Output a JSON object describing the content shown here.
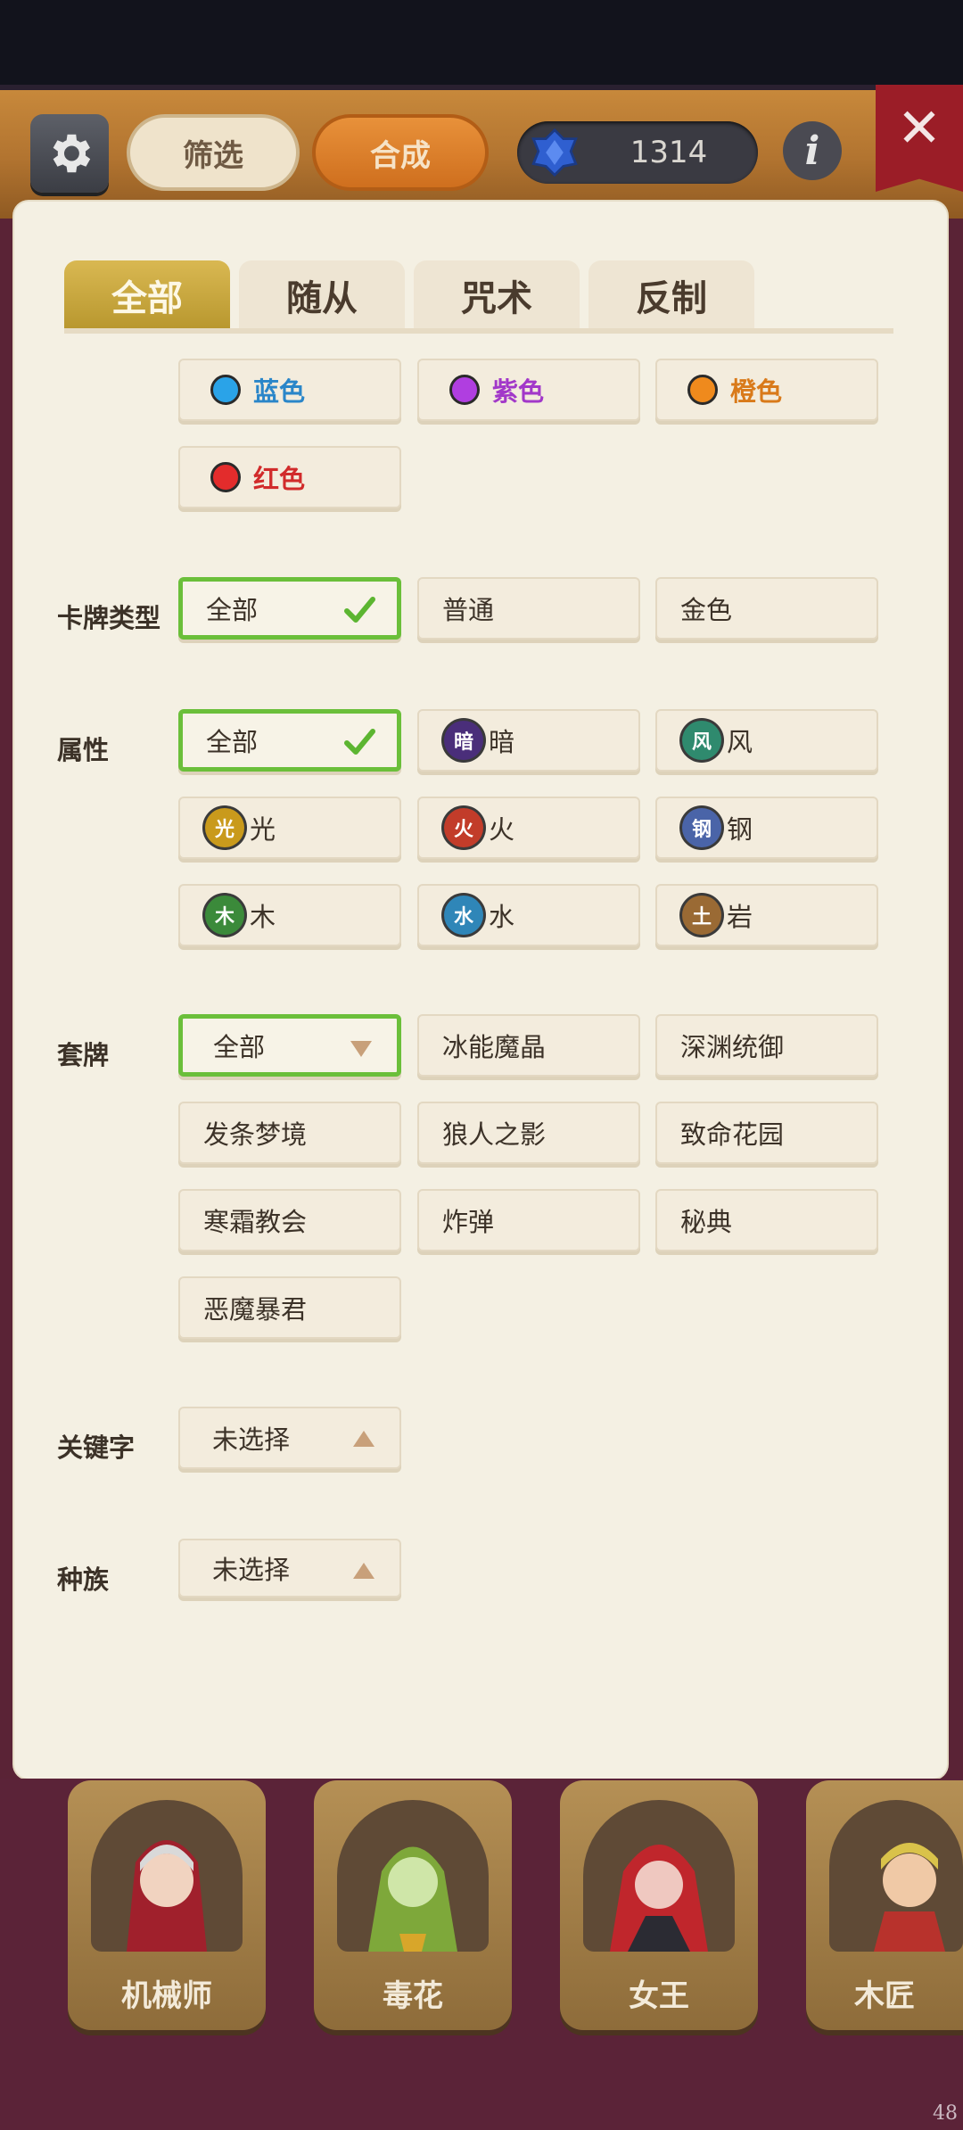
{
  "header": {
    "filter_label": "筛选",
    "compose_label": "合成",
    "gem_count": "1314",
    "info_label": "i"
  },
  "tabs": [
    {
      "label": "全部",
      "active": true
    },
    {
      "label": "随从",
      "active": false
    },
    {
      "label": "咒术",
      "active": false
    },
    {
      "label": "反制",
      "active": false
    }
  ],
  "colors": [
    {
      "label": "蓝色",
      "color": "#2aa3e8",
      "text_color": "#2a86c9"
    },
    {
      "label": "紫色",
      "color": "#b03ee0",
      "text_color": "#a238c9"
    },
    {
      "label": "橙色",
      "color": "#ef8a1d",
      "text_color": "#d97a1a"
    },
    {
      "label": "红色",
      "color": "#e32c2c",
      "text_color": "#d12b2b"
    }
  ],
  "card_type": {
    "label": "卡牌类型",
    "options": [
      "全部",
      "普通",
      "金色"
    ]
  },
  "attribute": {
    "label": "属性",
    "all": "全部",
    "options": [
      {
        "icon": "暗",
        "label": "暗",
        "color": "#4a2e7a"
      },
      {
        "icon": "风",
        "label": "风",
        "color": "#2f8a6e"
      },
      {
        "icon": "光",
        "label": "光",
        "color": "#c99a1c"
      },
      {
        "icon": "火",
        "label": "火",
        "color": "#c23c2a"
      },
      {
        "icon": "钢",
        "label": "钢",
        "color": "#4a64a8"
      },
      {
        "icon": "木",
        "label": "木",
        "color": "#3b8a3a"
      },
      {
        "icon": "水",
        "label": "水",
        "color": "#2f86b8"
      },
      {
        "icon": "土",
        "label": "岩",
        "color": "#9a6a34"
      }
    ]
  },
  "deck": {
    "label": "套牌",
    "all": "全部",
    "options": [
      "冰能魔晶",
      "深渊统御",
      "发条梦境",
      "狼人之影",
      "致命花园",
      "寒霜教会",
      "炸弹",
      "秘典",
      "恶魔暴君"
    ]
  },
  "keyword": {
    "label": "关键字",
    "value": "未选择"
  },
  "race": {
    "label": "种族",
    "value": "未选择"
  },
  "heroes": [
    "机械师",
    "毒花",
    "女王",
    "木匠"
  ],
  "corner_number": "48"
}
